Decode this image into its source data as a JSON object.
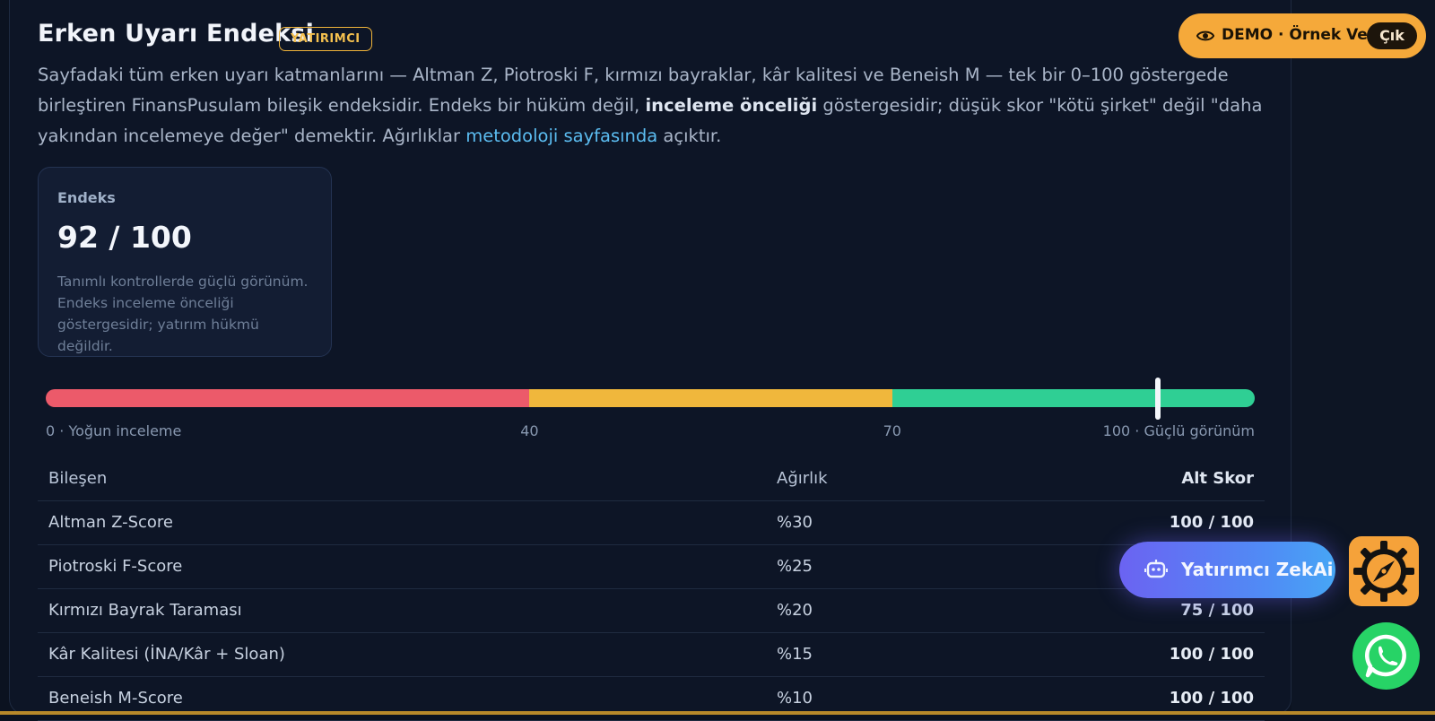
{
  "section": {
    "title": "Erken Uyarı Endeksi",
    "badge": "YATIRIMCI",
    "desc_1": "Sayfadaki tüm erken uyarı katmanlarını — Altman Z, Piotroski F, kırmızı bayraklar, kâr kalitesi ve Beneish M — tek bir 0–100 göstergede birleştiren FinansPusulam bileşik endeksidir. Endeks bir hüküm değil, ",
    "desc_bold": "inceleme önceliği",
    "desc_2": " göstergesidir; düşük skor \"kötü şirket\" değil \"daha yakından incelemeye değer\" demektir. Ağırlıklar ",
    "desc_link": "metodoloji sayfasında",
    "desc_3": " açıktır."
  },
  "score_card": {
    "label": "Endeks",
    "value": "92 / 100",
    "score": 92,
    "note": "Tanımlı kontrollerde güçlü görünüm. Endeks inceleme önceliği göstergesidir; yatırım hükmü değildir."
  },
  "gauge": {
    "thresholds": [
      40,
      70
    ],
    "colors": [
      "#ec5a6a",
      "#f0b73c",
      "#2fcf94"
    ],
    "label_min": "0 · Yoğun inceleme",
    "label_40": "40",
    "label_70": "70",
    "label_max": "100 · Güçlü görünüm"
  },
  "table": {
    "headers": {
      "component": "Bileşen",
      "weight": "Ağırlık",
      "sub_score": "Alt Skor"
    },
    "rows": [
      {
        "name": "Altman Z-Score",
        "weight": "%30",
        "score": "100 / 100"
      },
      {
        "name": "Piotroski F-Score",
        "weight": "%25",
        "score": ""
      },
      {
        "name": "Kırmızı Bayrak Taraması",
        "weight": "%20",
        "score": "75 / 100"
      },
      {
        "name": "Kâr Kalitesi (İNA/Kâr + Sloan)",
        "weight": "%15",
        "score": "100 / 100"
      },
      {
        "name": "Beneish M-Score",
        "weight": "%10",
        "score": "100 / 100"
      }
    ]
  },
  "demo": {
    "label": "DEMO · Örnek Veri",
    "exit": "Çık",
    "icon": "eye-icon"
  },
  "assistant": {
    "label": "Yatırımcı ZekAi",
    "icon": "robot-icon"
  },
  "floating": {
    "compass_icon": "compass-gear-icon",
    "whatsapp_icon": "whatsapp-icon"
  }
}
